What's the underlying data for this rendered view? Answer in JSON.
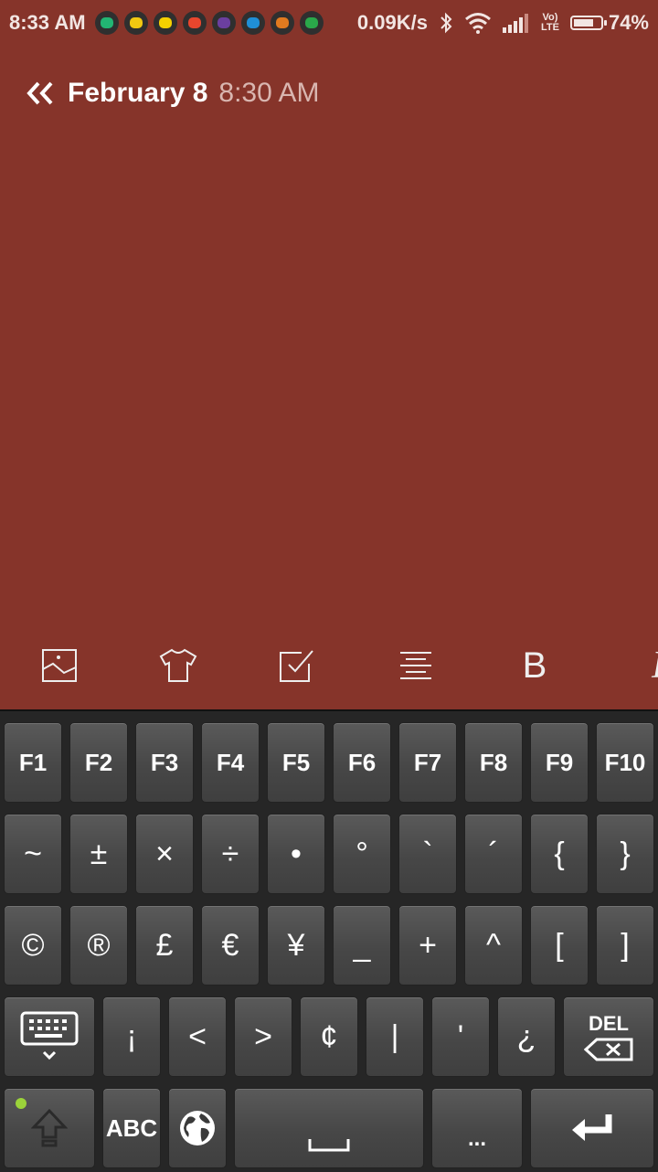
{
  "status_bar": {
    "time": "8:33 AM",
    "notification_icons": [
      "green-app-icon",
      "yellow-app-icon",
      "yellow-dot-icon",
      "bs-app-icon",
      "purple-app-icon",
      "download-icon",
      "orange-app-icon",
      "green-m-icon"
    ],
    "notification_colors": [
      "#22b573",
      "#f2c811",
      "#f5d000",
      "#e8462d",
      "#6b3fa0",
      "#1f8fd6",
      "#e07a1f",
      "#2aa84a"
    ],
    "net_speed": "0.09K/s",
    "lte_top": "Vo)",
    "lte_bottom": "LTE",
    "battery_percent": "74%",
    "battery_level": 0.74
  },
  "header": {
    "date": "February 8",
    "time": "8:30 AM"
  },
  "toolbar": {
    "bold_label": "B",
    "italic_label": "I",
    "icons": [
      "image-icon",
      "shirt-icon",
      "checkbox-icon",
      "align-icon",
      "bold-icon",
      "italic-icon"
    ]
  },
  "keyboard": {
    "row1": [
      "F1",
      "F2",
      "F3",
      "F4",
      "F5",
      "F6",
      "F7",
      "F8",
      "F9",
      "F10"
    ],
    "row2": [
      "~",
      "±",
      "×",
      "÷",
      "•",
      "°",
      "`",
      "´",
      "{",
      "}"
    ],
    "row3": [
      "©",
      "®",
      "£",
      "€",
      "¥",
      "_",
      "+",
      "^",
      "[",
      "]"
    ],
    "row4": [
      "¡",
      "<",
      ">",
      "¢",
      "|",
      "'",
      "¿"
    ],
    "delete_label": "DEL",
    "abc_label": "ABC",
    "dots_label": "...",
    "shift_led_color": "#9bd33a"
  }
}
